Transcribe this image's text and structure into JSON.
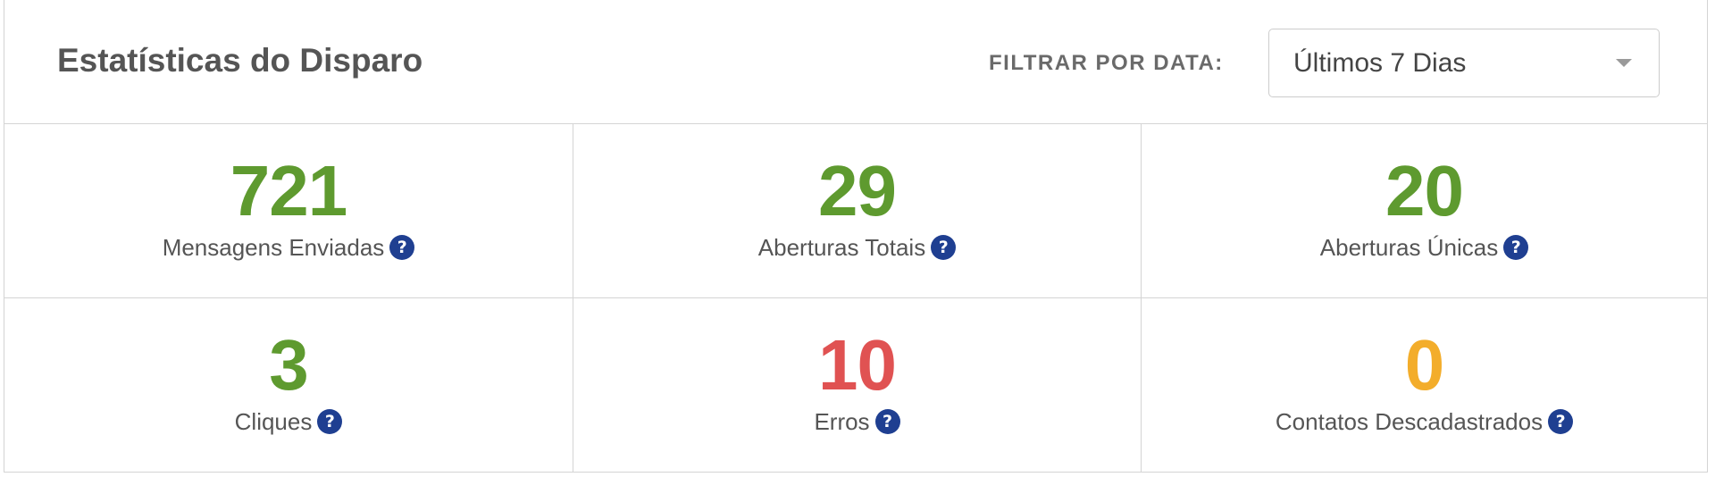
{
  "header": {
    "title": "Estatísticas do Disparo",
    "filter_label": "FILTRAR POR DATA:",
    "filter_select": {
      "selected": "Últimos 7 Dias"
    }
  },
  "colors": {
    "positive": "#5e9a2f",
    "error": "#e05252",
    "warning": "#f3ad2b",
    "help_icon": "#1f3f91"
  },
  "help_icon_glyph": "?",
  "stats": [
    {
      "value": "721",
      "label": "Mensagens Enviadas",
      "color": "#5e9a2f"
    },
    {
      "value": "29",
      "label": "Aberturas Totais",
      "color": "#5e9a2f"
    },
    {
      "value": "20",
      "label": "Aberturas Únicas",
      "color": "#5e9a2f"
    },
    {
      "value": "3",
      "label": "Cliques",
      "color": "#5e9a2f"
    },
    {
      "value": "10",
      "label": "Erros",
      "color": "#e05252"
    },
    {
      "value": "0",
      "label": "Contatos Descadastrados",
      "color": "#f3ad2b"
    }
  ]
}
